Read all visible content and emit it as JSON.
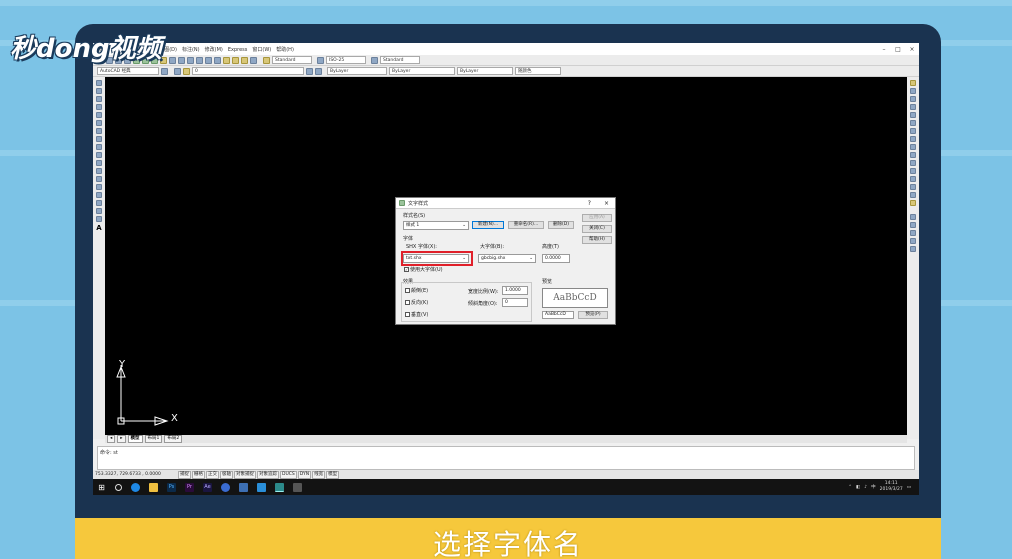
{
  "watermark": {
    "logo_text": "秒dong视频"
  },
  "app": {
    "menu": [
      "入(I)",
      "格式(O)",
      "工具(T)",
      "绘图(D)",
      "标注(N)",
      "修改(M)",
      "Express",
      "窗口(W)",
      "帮助(H)"
    ],
    "toolbar1": {
      "text_style_select": "Standard",
      "dim_style_select": "ISO-25",
      "table_style_select": "Standard"
    },
    "toolbar2": {
      "workspace_select": "AutoCAD 经典",
      "layer_select": "0",
      "color_select": "ByLayer",
      "linetype_select": "ByLayer",
      "lineweight_select": "ByLayer",
      "plotstyle_select": "随颜色"
    }
  },
  "canvas": {
    "y_axis": "Y",
    "x_axis": "X"
  },
  "tabs": [
    "模型",
    "布局1",
    "布局2"
  ],
  "command": {
    "line1": "命令: st"
  },
  "status": {
    "coords": "753.3327, 729.6733 , 0.0000",
    "toggles": [
      "捕捉",
      "栅格",
      "正交",
      "极轴",
      "对象捕捉",
      "对象追踪",
      "DUCS",
      "DYN",
      "线宽",
      "模型"
    ]
  },
  "taskbar": {
    "time": "14:11",
    "date": "2019/3/27"
  },
  "dialog": {
    "title": "文字样式",
    "help_glyph": "?",
    "close_glyph": "×",
    "style_name_label": "样式名(S)",
    "style_name_value": "样式 1",
    "new_button": "新建(N)...",
    "rename_button": "重命名(R)...",
    "delete_button": "删除(D)",
    "apply_button": "应用(A)",
    "close_button": "关闭(C)",
    "help_button": "帮助(H)",
    "font_group_label": "字体",
    "shx_font_label": "SHX 字体(X):",
    "shx_font_value": "txt.shx",
    "bigfont_label": "大字体(B):",
    "bigfont_value": "gbcbig.shx",
    "height_label": "高度(T)",
    "height_value": "0.0000",
    "use_bigfont_label": "使用大字体(U)",
    "effects_label": "效果",
    "upside_down_label": "颠倒(E)",
    "backwards_label": "反向(K)",
    "vertical_label": "垂直(V)",
    "width_factor_label": "宽度比例(W):",
    "width_factor_value": "1.0000",
    "oblique_label": "倾斜角度(O):",
    "oblique_value": "0",
    "preview_label": "预览",
    "preview_text": "AaBbCcD",
    "preview_input": "AaBbCcD",
    "preview_button": "预览(P)"
  },
  "caption": "选择字体名"
}
